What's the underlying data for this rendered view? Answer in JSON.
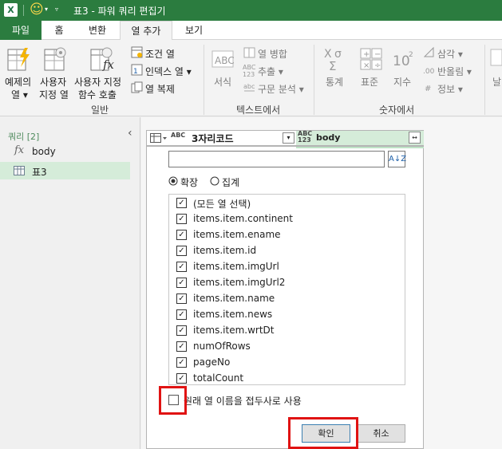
{
  "titlebar": {
    "app_icon": "X",
    "title": "표3 - 파워 쿼리 편집기",
    "smiley": "☺"
  },
  "tabs": [
    "파일",
    "홈",
    "변환",
    "열 추가",
    "보기"
  ],
  "ribbon": {
    "general": {
      "example_col_line1": "예제의",
      "example_col_line2": "열 ▾",
      "custom_col_line1": "사용자",
      "custom_col_line2": "지정 열",
      "invoke_fn_line1": "사용자 지정",
      "invoke_fn_line2": "함수 호출",
      "conditional_col": "조건 열",
      "index_col": "인덱스 열 ▾",
      "duplicate_col": "열 복제",
      "group_label": "일반"
    },
    "text": {
      "format": "서식",
      "merge_col": "열 병합",
      "extract": "추출 ▾",
      "parse": "구문 분석 ▾",
      "group_label": "텍스트에서"
    },
    "number": {
      "statistics": "통계",
      "standard": "표준",
      "scientific": "지수",
      "trig": "삼각 ▾",
      "rounding": "반올림 ▾",
      "info": "정보 ▾",
      "group_label": "숫자에서",
      "cut_label": "날"
    }
  },
  "sidebar": {
    "header": "쿼리 [2]",
    "queries": [
      {
        "label": "body",
        "icon": "fx-icon"
      },
      {
        "label": "표3",
        "icon": "table-icon"
      }
    ]
  },
  "column_header": {
    "type1": "ABC",
    "type1b": "C",
    "col1_name": "3자리코드",
    "type2_top": "ABC",
    "type2_bottom": "123",
    "col2_name": "body"
  },
  "popup": {
    "search_placeholder": "",
    "sort_icon_label": "A↓Z",
    "radio_expand": "확장",
    "radio_aggregate": "집계",
    "items": [
      "(모든 열 선택)",
      "items.item.continent",
      "items.item.ename",
      "items.item.id",
      "items.item.imgUrl",
      "items.item.imgUrl2",
      "items.item.name",
      "items.item.news",
      "items.item.wrtDt",
      "numOfRows",
      "pageNo",
      "totalCount"
    ],
    "prefix_label": "원래 열 이름을 접두사로 사용",
    "ok": "확인",
    "cancel": "취소"
  },
  "colors": {
    "title_bg": "#2b7c3f",
    "highlight": "#e01313",
    "selected_query": "#d5ecd9"
  }
}
